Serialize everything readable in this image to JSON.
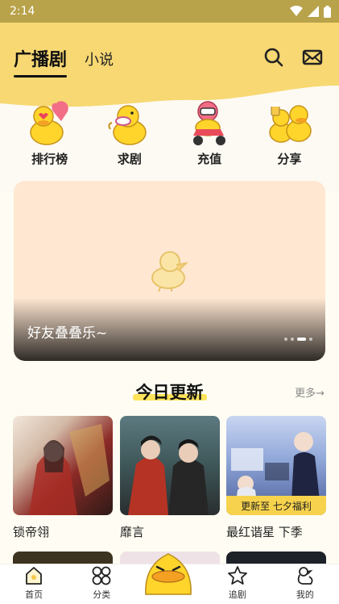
{
  "status": {
    "time": "2:14"
  },
  "tabs": {
    "active": "广播剧",
    "other": "小说"
  },
  "quick": [
    {
      "label": "排行榜",
      "icon": "duck-heart-icon"
    },
    {
      "label": "求剧",
      "icon": "duck-mic-icon"
    },
    {
      "label": "充值",
      "icon": "duck-scooter-icon"
    },
    {
      "label": "分享",
      "icon": "duck-cheers-icon"
    }
  ],
  "banner": {
    "title": "好友叠叠乐~"
  },
  "section": {
    "title": "今日更新",
    "more": "更多→"
  },
  "cards": [
    {
      "title": "锁帝翎",
      "badge": ""
    },
    {
      "title": "靡言",
      "badge": ""
    },
    {
      "title": "最红谐星 下季",
      "badge": "更新至 七夕福利"
    }
  ],
  "nav": [
    {
      "label": "首页"
    },
    {
      "label": "分类"
    },
    {
      "label": "追剧"
    },
    {
      "label": "我的"
    }
  ],
  "colors": {
    "brand_yellow": "#f7d873",
    "status_bar": "#b8a24a",
    "badge": "#f7d34d"
  }
}
